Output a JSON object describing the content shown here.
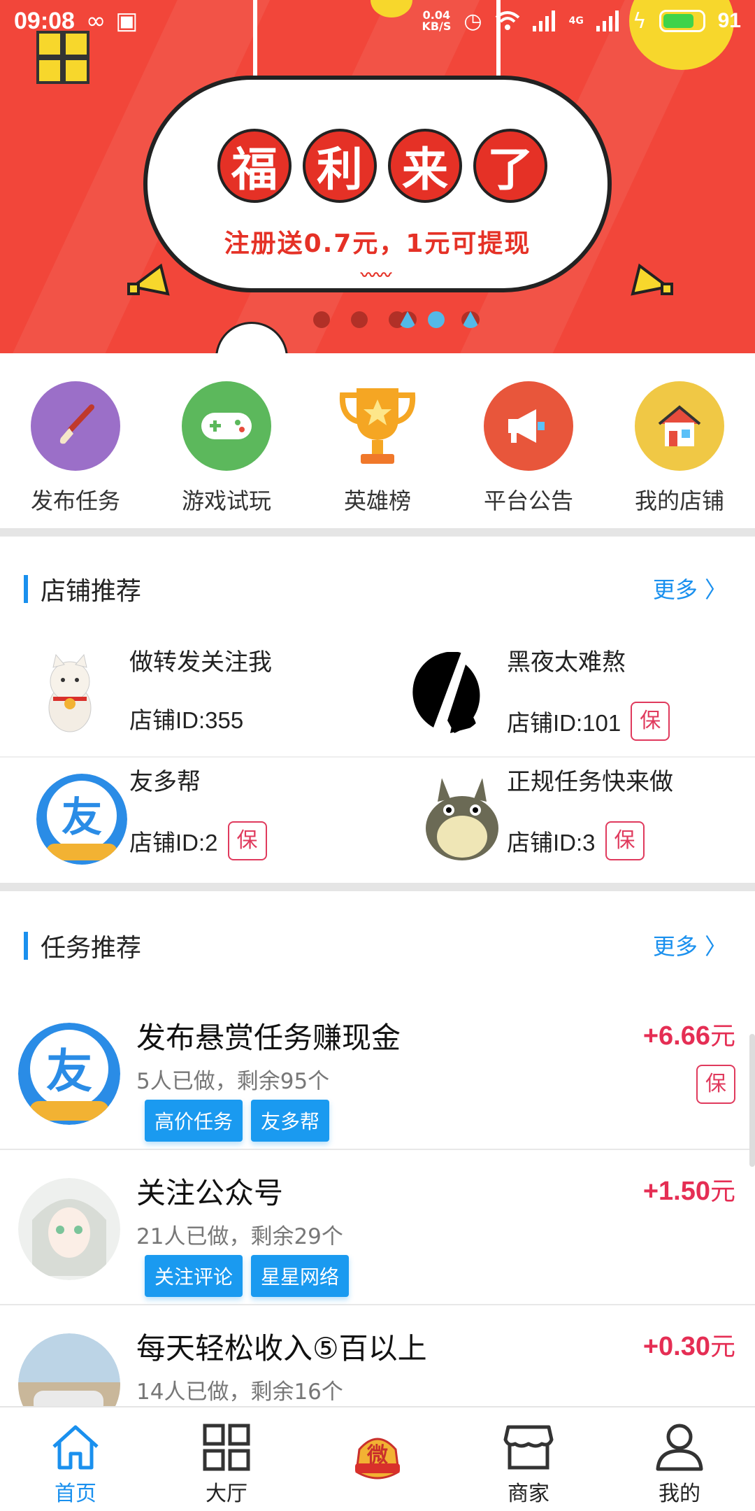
{
  "status_bar": {
    "time": "09:08",
    "net_speed_value": "0.04",
    "net_speed_unit": "KB/S",
    "network_type": "4G",
    "battery": "91"
  },
  "banner": {
    "title_chars": [
      "福",
      "利",
      "来",
      "了"
    ],
    "subtitle": "注册送0.7元，1元可提现",
    "page_count": 6,
    "active_page": 4
  },
  "quick_actions": [
    {
      "label": "发布任务",
      "icon": "brush-icon",
      "color": "#9b6fc8"
    },
    {
      "label": "游戏试玩",
      "icon": "gamepad-icon",
      "color": "#5cb85c"
    },
    {
      "label": "英雄榜",
      "icon": "trophy-icon",
      "color": "#f0a020"
    },
    {
      "label": "平台公告",
      "icon": "megaphone-icon",
      "color": "#e8563b"
    },
    {
      "label": "我的店铺",
      "icon": "house-icon",
      "color": "#f0c845"
    }
  ],
  "shop_section": {
    "title": "店铺推荐",
    "more": "更多 〉",
    "shops": [
      {
        "name": "做转发关注我",
        "id_text": "店铺ID:355",
        "guarantee": ""
      },
      {
        "name": "黑夜太难熬",
        "id_text": "店铺ID:101",
        "guarantee": "保"
      },
      {
        "name": "友多帮",
        "id_text": "店铺ID:2",
        "guarantee": "保"
      },
      {
        "name": "正规任务快来做",
        "id_text": "店铺ID:3",
        "guarantee": "保"
      }
    ]
  },
  "task_section": {
    "title": "任务推荐",
    "more": "更多 〉",
    "tasks": [
      {
        "title": "发布悬赏任务赚现金",
        "stat": "5人已做，剩余95个",
        "tags": [
          "高价任务",
          "友多帮"
        ],
        "reward": "+6.66",
        "unit": "元",
        "guarantee": "保"
      },
      {
        "title": "关注公众号",
        "stat": "21人已做，剩余29个",
        "tags": [
          "关注评论",
          "星星网络"
        ],
        "reward": "+1.50",
        "unit": "元",
        "guarantee": ""
      },
      {
        "title": "每天轻松收入⑤百以上",
        "stat": "14人已做，剩余16个",
        "tags": [],
        "reward": "+0.30",
        "unit": "元",
        "guarantee": ""
      }
    ]
  },
  "logo_text": {
    "center_tab_badge": "微"
  },
  "bottom_nav": [
    {
      "label": "首页",
      "icon": "home-icon",
      "active": true
    },
    {
      "label": "大厅",
      "icon": "grid-icon",
      "active": false
    },
    {
      "label": "",
      "icon": "center-badge-icon",
      "active": false
    },
    {
      "label": "商家",
      "icon": "store-icon",
      "active": false
    },
    {
      "label": "我的",
      "icon": "user-icon",
      "active": false
    }
  ],
  "colors": {
    "accent": "#1a90ee",
    "price": "#e52e54",
    "banner": "#f2463a"
  }
}
